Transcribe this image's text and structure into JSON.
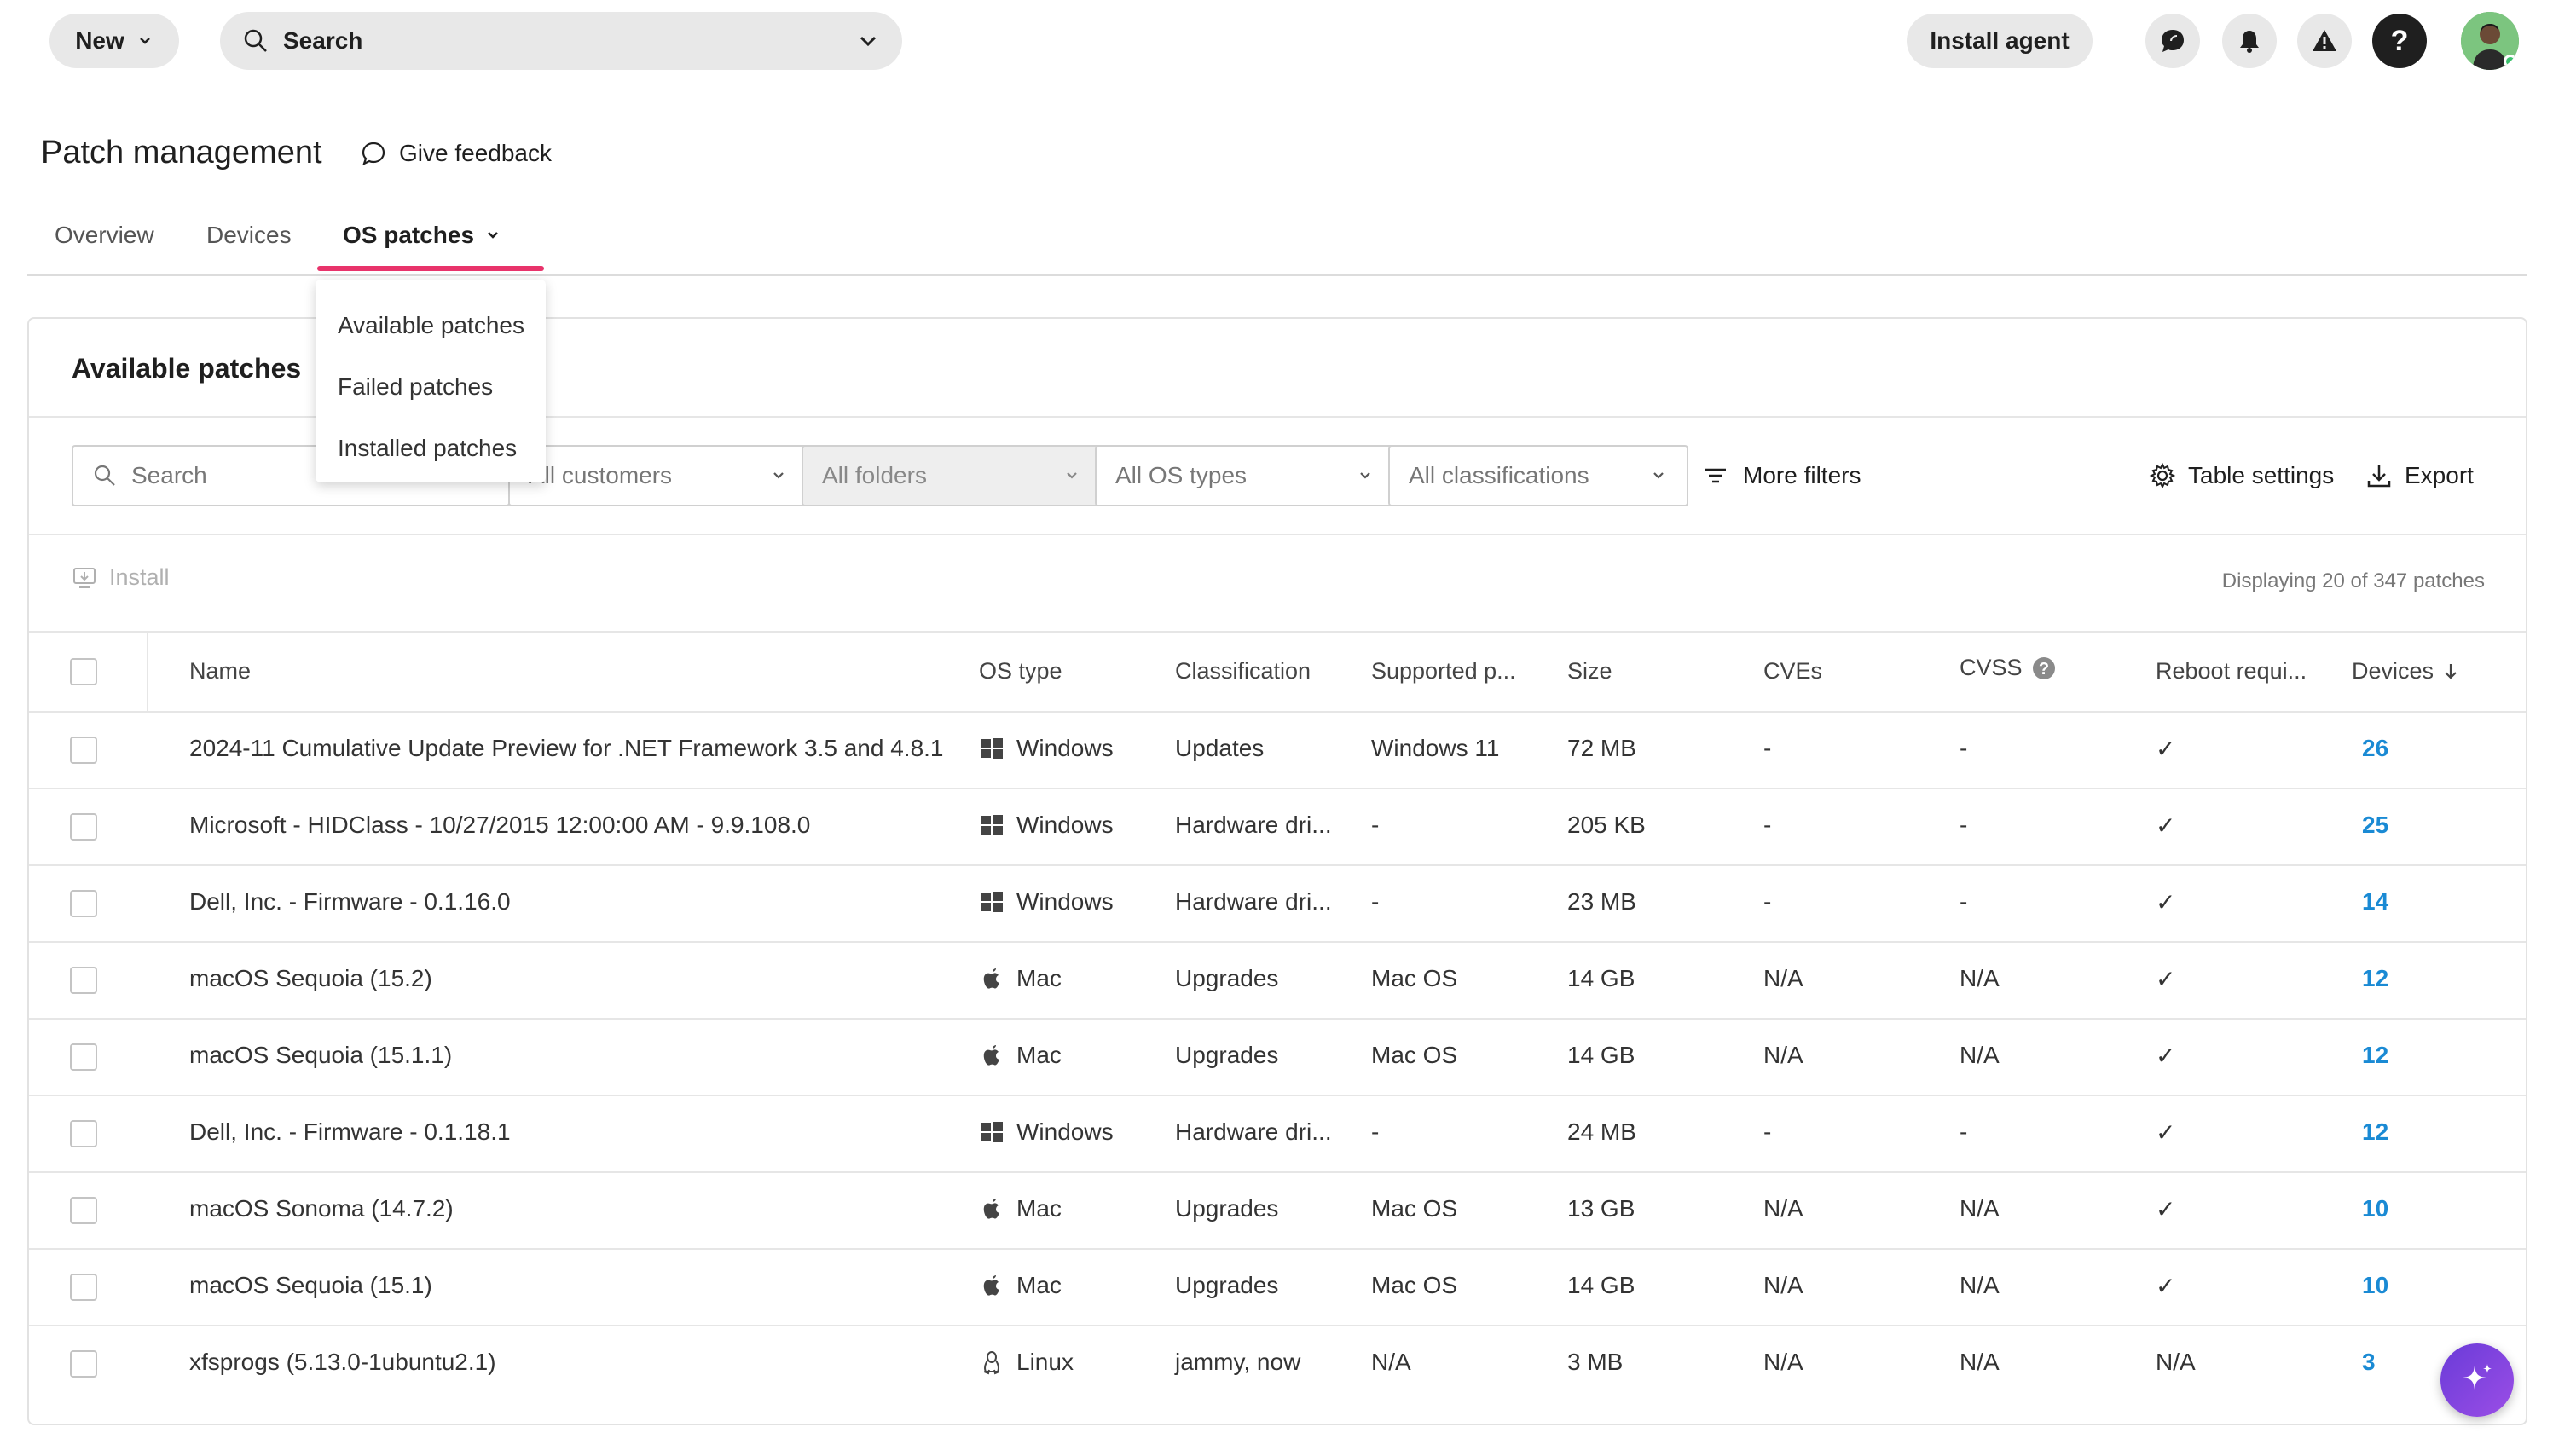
{
  "topbar": {
    "new_label": "New",
    "search_label": "Search",
    "install_agent_label": "Install agent",
    "help_label": "?"
  },
  "header": {
    "title": "Patch management",
    "feedback_label": "Give feedback"
  },
  "tabs": [
    {
      "label": "Overview"
    },
    {
      "label": "Devices"
    },
    {
      "label": "OS patches"
    }
  ],
  "dropdown": {
    "items": [
      "Available patches",
      "Failed patches",
      "Installed patches"
    ]
  },
  "card": {
    "title": "Available patches",
    "filters": {
      "search_placeholder": "Search",
      "customers": "All customers",
      "folders": "All folders",
      "os_types": "All OS types",
      "classifications": "All classifications"
    },
    "more_filters_label": "More filters",
    "table_settings_label": "Table settings",
    "export_label": "Export",
    "install_label": "Install",
    "displaying": "Displaying 20 of 347 patches"
  },
  "table": {
    "columns": [
      "Name",
      "OS type",
      "Classification",
      "Supported p...",
      "Size",
      "CVEs",
      "CVSS",
      "Reboot requi...",
      "Devices"
    ],
    "rows": [
      {
        "name": "2024-11 Cumulative Update Preview for .NET Framework 3.5 and 4.8.1",
        "os": "Windows",
        "os_icon": "windows-icon",
        "classification": "Updates",
        "supported": "Windows 11",
        "size": "72 MB",
        "cves": "-",
        "cvss": "-",
        "reboot": "✓",
        "devices": "26"
      },
      {
        "name": "Microsoft - HIDClass - 10/27/2015 12:00:00 AM - 9.9.108.0",
        "os": "Windows",
        "os_icon": "windows-icon",
        "classification": "Hardware dri...",
        "supported": "-",
        "size": "205 KB",
        "cves": "-",
        "cvss": "-",
        "reboot": "✓",
        "devices": "25"
      },
      {
        "name": "Dell, Inc. - Firmware - 0.1.16.0",
        "os": "Windows",
        "os_icon": "windows-icon",
        "classification": "Hardware dri...",
        "supported": "-",
        "size": "23 MB",
        "cves": "-",
        "cvss": "-",
        "reboot": "✓",
        "devices": "14"
      },
      {
        "name": "macOS Sequoia (15.2)",
        "os": "Mac",
        "os_icon": "apple-icon",
        "classification": "Upgrades",
        "supported": "Mac OS",
        "size": "14 GB",
        "cves": "N/A",
        "cvss": "N/A",
        "reboot": "✓",
        "devices": "12"
      },
      {
        "name": "macOS Sequoia (15.1.1)",
        "os": "Mac",
        "os_icon": "apple-icon",
        "classification": "Upgrades",
        "supported": "Mac OS",
        "size": "14 GB",
        "cves": "N/A",
        "cvss": "N/A",
        "reboot": "✓",
        "devices": "12"
      },
      {
        "name": "Dell, Inc. - Firmware - 0.1.18.1",
        "os": "Windows",
        "os_icon": "windows-icon",
        "classification": "Hardware dri...",
        "supported": "-",
        "size": "24 MB",
        "cves": "-",
        "cvss": "-",
        "reboot": "✓",
        "devices": "12"
      },
      {
        "name": "macOS Sonoma (14.7.2)",
        "os": "Mac",
        "os_icon": "apple-icon",
        "classification": "Upgrades",
        "supported": "Mac OS",
        "size": "13 GB",
        "cves": "N/A",
        "cvss": "N/A",
        "reboot": "✓",
        "devices": "10"
      },
      {
        "name": "macOS Sequoia (15.1)",
        "os": "Mac",
        "os_icon": "apple-icon",
        "classification": "Upgrades",
        "supported": "Mac OS",
        "size": "14 GB",
        "cves": "N/A",
        "cvss": "N/A",
        "reboot": "✓",
        "devices": "10"
      },
      {
        "name": "xfsprogs (5.13.0-1ubuntu2.1)",
        "os": "Linux",
        "os_icon": "linux-icon",
        "classification": "jammy, now",
        "supported": "N/A",
        "size": "3 MB",
        "cves": "N/A",
        "cvss": "N/A",
        "reboot": "N/A",
        "devices": "3"
      }
    ]
  },
  "colors": {
    "accent": "#e8336b",
    "link": "#1a8ad4",
    "ai_button": "#7b42dd"
  }
}
